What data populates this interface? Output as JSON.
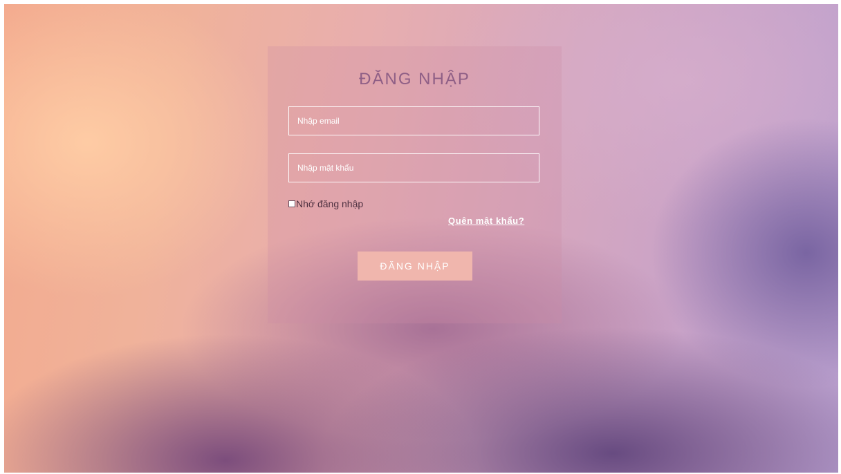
{
  "login": {
    "title": "ĐĂNG NHẬP",
    "email_placeholder": "Nhập email",
    "password_placeholder": "Nhập mật khẩu",
    "remember_label": "Nhớ đăng nhập",
    "remember_checked": false,
    "forgot_label": "Quên mật khẩu?",
    "submit_label": "ĐĂNG NHẬP"
  },
  "colors": {
    "title": "#8f5f86",
    "button_bg": "#f0b6ad",
    "button_text": "#ffffff",
    "field_border": "#ffffff"
  }
}
